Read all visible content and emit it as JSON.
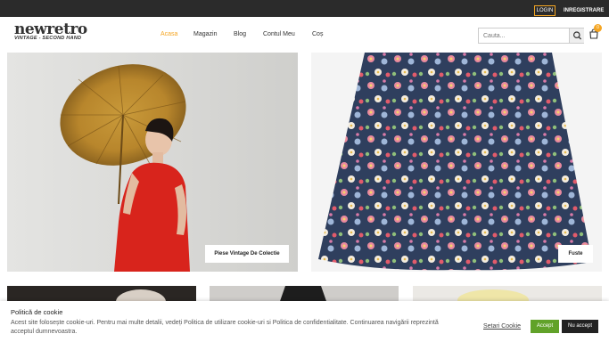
{
  "topbar": {
    "login_label": "LOGIN",
    "register_label": "INREGISTRARE"
  },
  "logo": {
    "main": "newretro",
    "sub": "VINTAGE - SECOND HAND"
  },
  "nav": {
    "items": [
      {
        "label": "Acasa"
      },
      {
        "label": "Magazin"
      },
      {
        "label": "Blog"
      },
      {
        "label": "Contul Meu"
      },
      {
        "label": "Coș"
      }
    ]
  },
  "search": {
    "placeholder": "Cauta..."
  },
  "cart": {
    "count": "0"
  },
  "tiles": [
    {
      "label": "Piese Vintage De Colectie"
    },
    {
      "label": "Fuste"
    }
  ],
  "cookie": {
    "title": "Politică de cookie",
    "text": "Acest site folosește cookie-uri. Pentru mai multe detalii, vedeți Politica de utilizare cookie-uri si Politica de confidentialitate. Continuarea navigării reprezintă acceptul dumnevoastra.",
    "settings_label": "Setari Cookie",
    "accept_label": "Accept",
    "reject_label": "Nu accept"
  },
  "colors": {
    "accent": "#f5a623",
    "topbar": "#2b2b2b",
    "accept": "#61a229"
  }
}
